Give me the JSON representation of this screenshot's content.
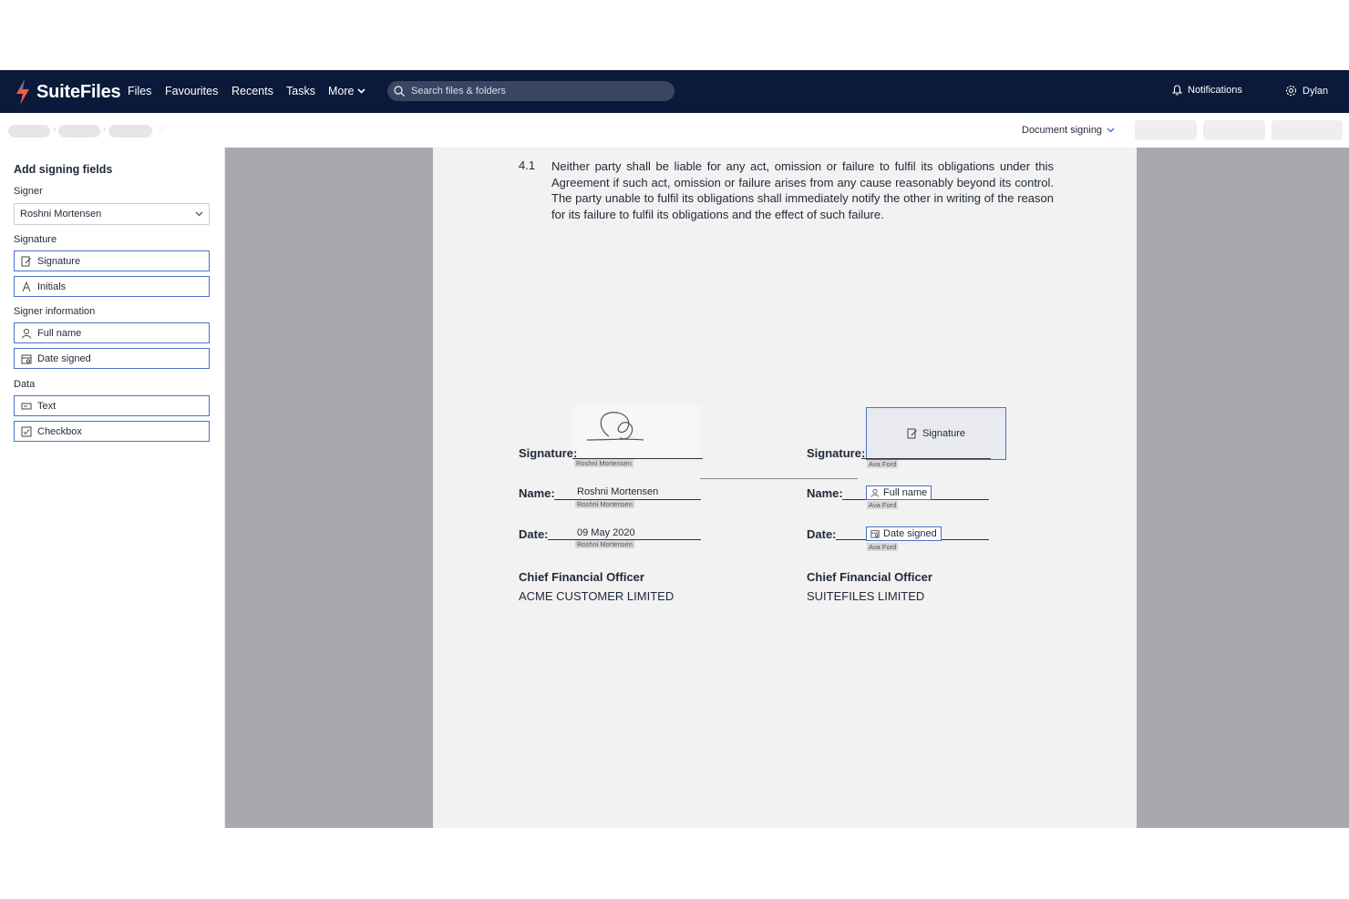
{
  "app": {
    "name": "SuiteFiles",
    "nav": [
      "Files",
      "Favourites",
      "Recents",
      "Tasks",
      "More"
    ],
    "search_placeholder": "Search files & folders",
    "notifications_label": "Notifications",
    "user_name": "Dylan",
    "brand_colors": {
      "navbar": "#0b1a3a",
      "accent": "#4a72c4"
    }
  },
  "toolbar": {
    "mode_label": "Document signing"
  },
  "sidebar": {
    "title": "Add signing fields",
    "signer_label": "Signer",
    "signer_value": "Roshni Mortensen",
    "sections": {
      "signature": {
        "label": "Signature",
        "items": [
          {
            "label": "Signature",
            "icon": "signature-icon"
          },
          {
            "label": "Initials",
            "icon": "initials-icon"
          }
        ]
      },
      "signer_info": {
        "label": "Signer information",
        "items": [
          {
            "label": "Full name",
            "icon": "person-icon"
          },
          {
            "label": "Date signed",
            "icon": "calendar-icon"
          }
        ]
      },
      "data": {
        "label": "Data",
        "items": [
          {
            "label": "Text",
            "icon": "text-field-icon"
          },
          {
            "label": "Checkbox",
            "icon": "checkbox-icon"
          }
        ]
      }
    }
  },
  "document": {
    "clause_number": "4.1",
    "clause_text": "Neither party shall be liable for any act, omission or failure to fulfil its obligations under this Agreement if such act, omission or failure arises from any cause reasonably beyond its control. The party unable to fulfil its obligations shall immediately notify the other in writing of the reason for its failure to fulfil its obligations and the effect of such failure.",
    "labels": {
      "signature": "Signature:",
      "name": "Name:",
      "date": "Date:"
    },
    "left_party": {
      "signer_tag": "Roshni Mortensen",
      "name_value": "Roshni Mortensen",
      "date_value": "09 May 2020",
      "role": "Chief Financial Officer",
      "company": "ACME CUSTOMER LIMITED"
    },
    "right_party": {
      "signer_tag": "Ava Ford",
      "signature_field": "Signature",
      "name_field": "Full name",
      "date_field": "Date signed",
      "role": "Chief Financial Officer",
      "company": "SUITEFILES LIMITED"
    }
  }
}
